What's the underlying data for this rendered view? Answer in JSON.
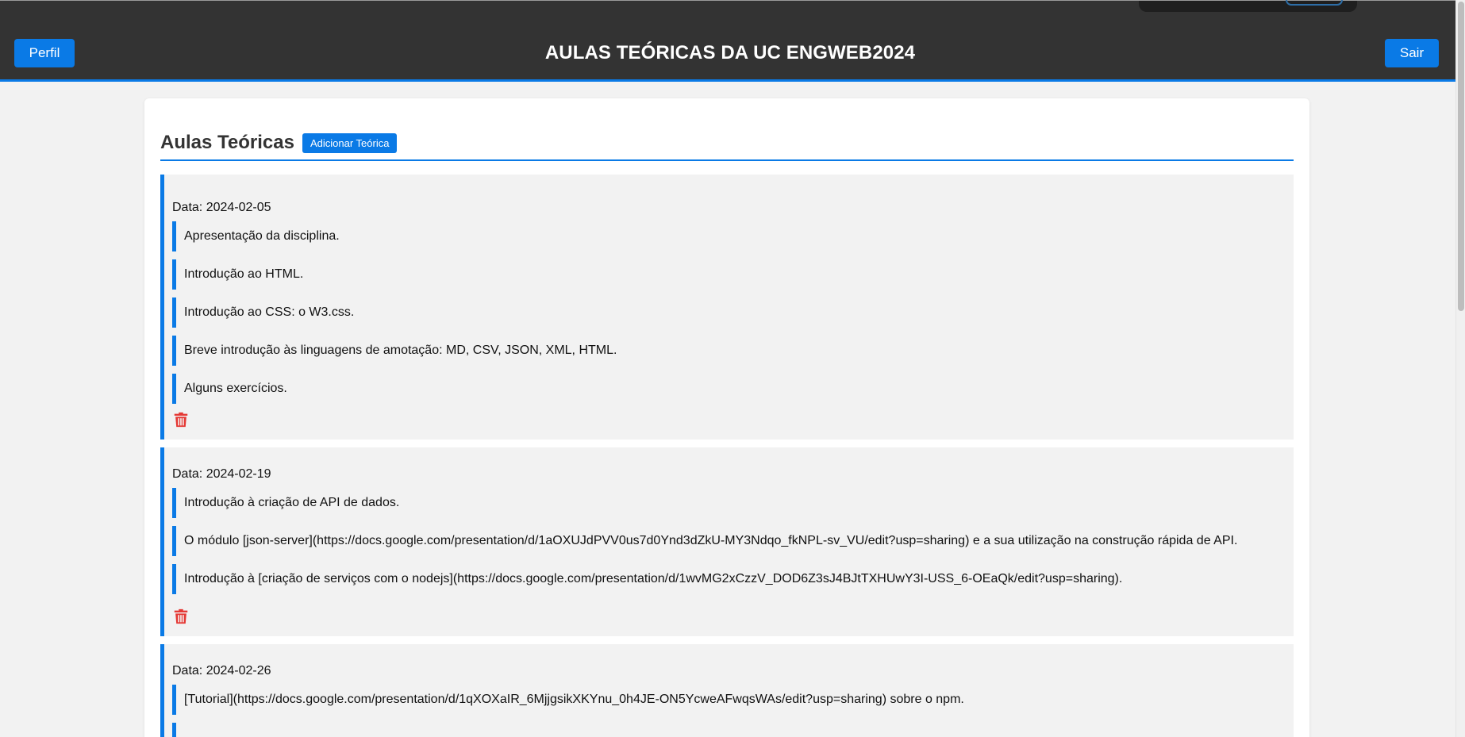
{
  "header": {
    "perfil_label": "Perfil",
    "title": "AULAS TEÓRICAS DA UC ENGWEB2024",
    "sair_label": "Sair"
  },
  "section": {
    "title": "Aulas Teóricas",
    "add_label": "Adicionar Teórica"
  },
  "aulas": [
    {
      "date": "Data: 2024-02-05",
      "topics": [
        "Apresentação da disciplina.",
        "Introdução ao HTML.",
        "Introdução ao CSS: o W3.css.",
        "Breve introdução às linguagens de amotação: MD, CSV, JSON, XML, HTML.",
        "Alguns exercícios."
      ]
    },
    {
      "date": "Data: 2024-02-19",
      "topics": [
        "Introdução à criação de API de dados.",
        "O módulo [json-server](https://docs.google.com/presentation/d/1aOXUJdPVV0us7d0Ynd3dZkU-MY3Ndqo_fkNPL-sv_VU/edit?usp=sharing) e a sua utilização na construção rápida de API.",
        "Introdução à [criação de serviços com o nodejs](https://docs.google.com/presentation/d/1wvMG2xCzzV_DOD6Z3sJ4BJtTXHUwY3I-USS_6-OEaQk/edit?usp=sharing)."
      ]
    },
    {
      "date": "Data: 2024-02-26",
      "topics": [
        "[Tutorial](https://docs.google.com/presentation/d/1qXOXaIR_6MjjgsikXKYnu_0h4JE-ON5YcweAFwqsWAs/edit?usp=sharing) sobre o npm."
      ]
    }
  ],
  "icons": {
    "delete": "trash-icon"
  },
  "colors": {
    "accent": "#0a7ae6",
    "header_bg": "#333333",
    "delete": "#e53935"
  }
}
